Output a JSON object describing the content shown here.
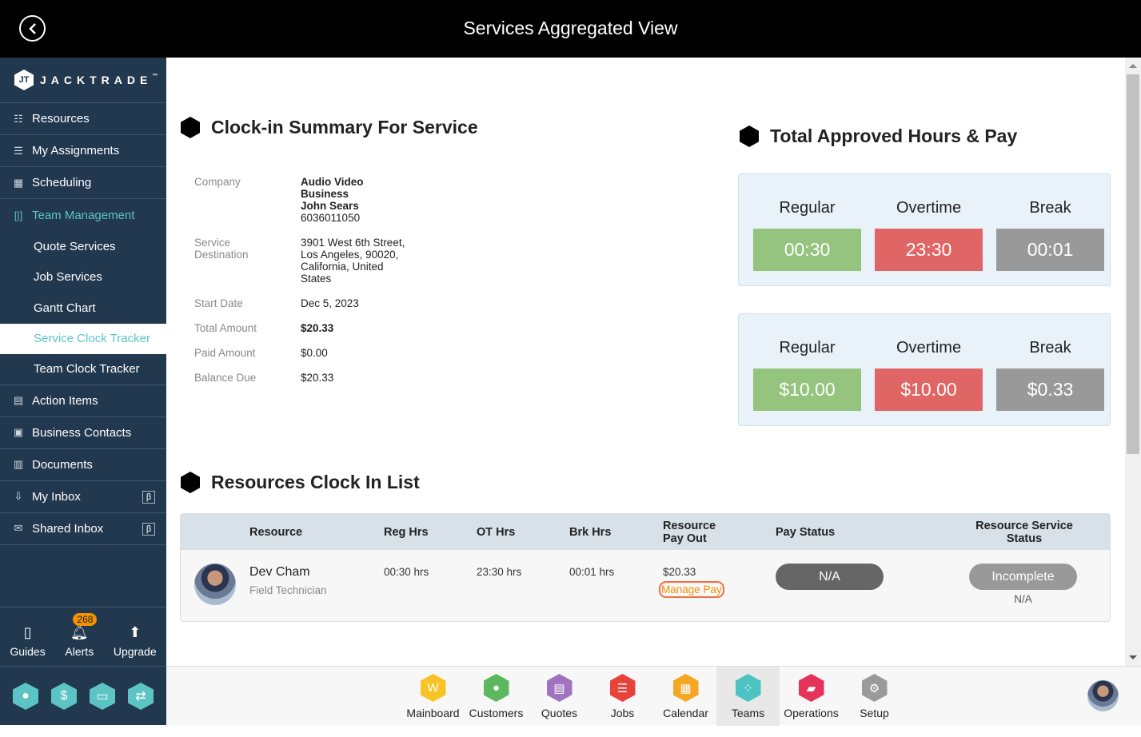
{
  "header": {
    "title": "Services Aggregated View",
    "back_icon": "chevron-left-circle-icon"
  },
  "sidebar": {
    "logo": {
      "mark": "JT",
      "name": "JACKTRADE",
      "tm": "™"
    },
    "items": [
      {
        "label": "Resources",
        "icon": "resources-icon"
      },
      {
        "label": "My Assignments",
        "icon": "assignments-icon"
      },
      {
        "label": "Scheduling",
        "icon": "calendar-clock-icon"
      },
      {
        "label": "Team Management",
        "icon": "team-management-icon"
      }
    ],
    "sub_items": [
      {
        "label": "Quote Services"
      },
      {
        "label": "Job Services"
      },
      {
        "label": "Gantt Chart"
      },
      {
        "label": "Service Clock Tracker"
      },
      {
        "label": "Team Clock Tracker"
      }
    ],
    "items2": [
      {
        "label": "Action Items",
        "icon": "clipboard-icon"
      },
      {
        "label": "Business Contacts",
        "icon": "contacts-icon"
      },
      {
        "label": "Documents",
        "icon": "document-icon"
      },
      {
        "label": "My Inbox",
        "icon": "inbox-icon",
        "badge": "β"
      },
      {
        "label": "Shared Inbox",
        "icon": "mail-icon",
        "badge": "β"
      }
    ],
    "tools": [
      {
        "label": "Guides",
        "icon": "book-icon"
      },
      {
        "label": "Alerts",
        "icon": "bell-icon",
        "count": "268"
      },
      {
        "label": "Upgrade",
        "icon": "arrow-up-icon"
      }
    ],
    "quick_icons": [
      "user-icon",
      "dollar-icon",
      "money-icon",
      "workflow-icon"
    ]
  },
  "clockin": {
    "title": "Clock-in Summary For Service",
    "company_label": "Company",
    "company_name_1": "Audio Video",
    "company_name_2": "Business",
    "contact_name": "John Sears",
    "phone": "6036011050",
    "destination_label_1": "Service",
    "destination_label_2": "Destination",
    "destination": "3901 West 6th Street, Los Angeles, 90020, California, United States",
    "start_date_label": "Start Date",
    "start_date": "Dec 5, 2023",
    "total_amount_label": "Total Amount",
    "total_amount": "$20.33",
    "paid_amount_label": "Paid Amount",
    "paid_amount": "$0.00",
    "balance_due_label": "Balance Due",
    "balance_due": "$20.33"
  },
  "approved": {
    "title": "Total Approved Hours & Pay",
    "hours": [
      {
        "label": "Regular",
        "value": "00:30",
        "color": "#94c47d"
      },
      {
        "label": "Overtime",
        "value": "23:30",
        "color": "#e06666"
      },
      {
        "label": "Break",
        "value": "00:01",
        "color": "#999999"
      }
    ],
    "pay": [
      {
        "label": "Regular",
        "value": "$10.00",
        "color": "#94c47d"
      },
      {
        "label": "Overtime",
        "value": "$10.00",
        "color": "#e06666"
      },
      {
        "label": "Break",
        "value": "$0.33",
        "color": "#999999"
      }
    ]
  },
  "resources": {
    "title": "Resources Clock In List",
    "columns": [
      "Resource",
      "Reg Hrs",
      "OT Hrs",
      "Brk Hrs",
      "Resource Pay Out",
      "Pay Status",
      "Resource Service Status"
    ],
    "rows": [
      {
        "name": "Dev Cham",
        "role": "Field Technician",
        "reg_hrs": "00:30 hrs",
        "ot_hrs": "23:30 hrs",
        "brk_hrs": "00:01 hrs",
        "pay_out": "$20.33",
        "manage_pay": "Manage Pay",
        "pay_status": "N/A",
        "service_status": "Incomplete",
        "service_status_sub": "N/A"
      }
    ]
  },
  "bottom_nav": [
    {
      "label": "Mainboard",
      "color": "#f7c325",
      "icon": "mainboard-icon"
    },
    {
      "label": "Customers",
      "color": "#5cb85c",
      "icon": "customer-icon"
    },
    {
      "label": "Quotes",
      "color": "#a073c1",
      "icon": "quotes-icon"
    },
    {
      "label": "Jobs",
      "color": "#e8433a",
      "icon": "jobs-list-icon"
    },
    {
      "label": "Calendar",
      "color": "#f5a623",
      "icon": "calendar-icon"
    },
    {
      "label": "Teams",
      "color": "#4ec3c3",
      "icon": "teams-icon",
      "selected": true
    },
    {
      "label": "Operations",
      "color": "#e6335a",
      "icon": "briefcase-icon"
    },
    {
      "label": "Setup",
      "color": "#9a9a9a",
      "icon": "gear-icon"
    }
  ]
}
